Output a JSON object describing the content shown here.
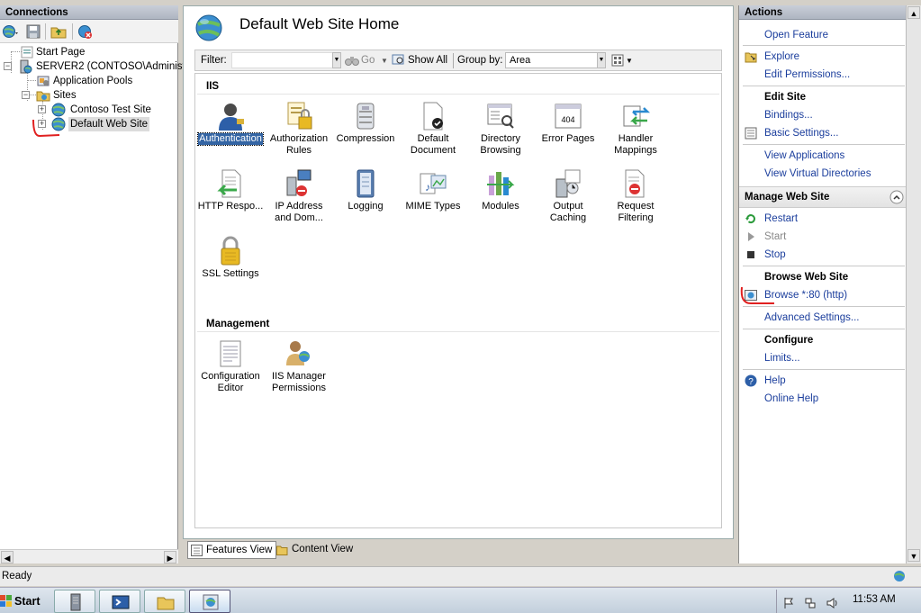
{
  "connections": {
    "title": "Connections",
    "tree": [
      {
        "label": "Start Page"
      },
      {
        "label": "SERVER2 (CONTOSO\\Administra"
      },
      {
        "label": "Application Pools"
      },
      {
        "label": "Sites"
      },
      {
        "label": "Contoso Test Site"
      },
      {
        "label": "Default Web Site"
      }
    ]
  },
  "center": {
    "title": "Default Web Site Home",
    "filter_label": "Filter:",
    "filter_value": "",
    "go_label": "Go",
    "show_all_label": "Show All",
    "group_by_label": "Group by:",
    "group_by_value": "Area",
    "groups": {
      "iis": {
        "title": "IIS",
        "features": [
          {
            "label": "Authentication",
            "icon": "authentication-icon"
          },
          {
            "label": "Authorization Rules",
            "icon": "authorization-icon"
          },
          {
            "label": "Compression",
            "icon": "compression-icon"
          },
          {
            "label": "Default Document",
            "icon": "default-document-icon"
          },
          {
            "label": "Directory Browsing",
            "icon": "directory-browsing-icon"
          },
          {
            "label": "Error Pages",
            "icon": "error-pages-icon"
          },
          {
            "label": "Handler Mappings",
            "icon": "handler-mappings-icon"
          },
          {
            "label": "HTTP Respo...",
            "icon": "http-response-icon"
          },
          {
            "label": "IP Address and Dom...",
            "icon": "ip-address-icon"
          },
          {
            "label": "Logging",
            "icon": "logging-icon"
          },
          {
            "label": "MIME Types",
            "icon": "mime-types-icon"
          },
          {
            "label": "Modules",
            "icon": "modules-icon"
          },
          {
            "label": "Output Caching",
            "icon": "output-caching-icon"
          },
          {
            "label": "Request Filtering",
            "icon": "request-filtering-icon"
          },
          {
            "label": "SSL Settings",
            "icon": "ssl-settings-icon"
          }
        ]
      },
      "management": {
        "title": "Management",
        "features": [
          {
            "label": "Configuration Editor",
            "icon": "configuration-editor-icon"
          },
          {
            "label": "IIS Manager Permissions",
            "icon": "iis-manager-permissions-icon"
          }
        ]
      }
    },
    "error_pages_badge": "404",
    "tabs": {
      "features_view": "Features View",
      "content_view": "Content View"
    }
  },
  "actions": {
    "title": "Actions",
    "open_feature": "Open Feature",
    "explore": "Explore",
    "edit_permissions": "Edit Permissions...",
    "edit_site_header": "Edit Site",
    "bindings": "Bindings...",
    "basic_settings": "Basic Settings...",
    "view_applications": "View Applications",
    "view_virtual_directories": "View Virtual Directories",
    "manage_web_site_header": "Manage Web Site",
    "restart": "Restart",
    "start": "Start",
    "stop": "Stop",
    "browse_web_site_header": "Browse Web Site",
    "browse": "Browse *:80 (http)",
    "advanced_settings": "Advanced Settings...",
    "configure_header": "Configure",
    "limits": "Limits...",
    "help": "Help",
    "online_help": "Online Help"
  },
  "status": {
    "text": "Ready"
  },
  "taskbar": {
    "start_label": "Start",
    "clock": "11:53 AM"
  },
  "colors": {
    "link": "#1a3d9c",
    "selection": "#3465a4",
    "annotation": "#e02020"
  }
}
